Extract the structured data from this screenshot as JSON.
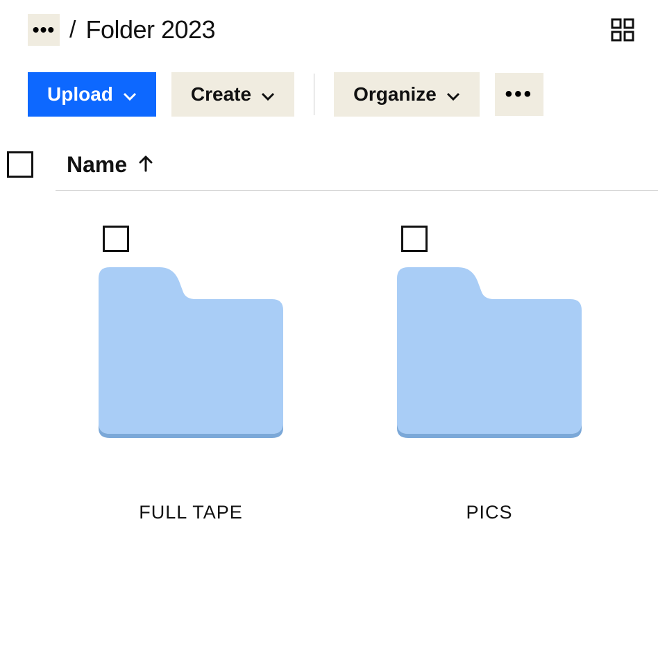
{
  "breadcrumb": {
    "more_label": "•••",
    "separator": "/",
    "current_folder": "Folder 2023"
  },
  "toolbar": {
    "upload_label": "Upload",
    "create_label": "Create",
    "organize_label": "Organize",
    "more_label": "•••"
  },
  "columns": {
    "name_label": "Name",
    "sort_direction": "asc"
  },
  "items": [
    {
      "label": "FULL TAPE"
    },
    {
      "label": "PICS"
    }
  ],
  "colors": {
    "primary": "#0d68ff",
    "secondary_bg": "#f0ece0",
    "folder_fill": "#a9cdf6",
    "folder_shadow": "#7ba8d8"
  }
}
